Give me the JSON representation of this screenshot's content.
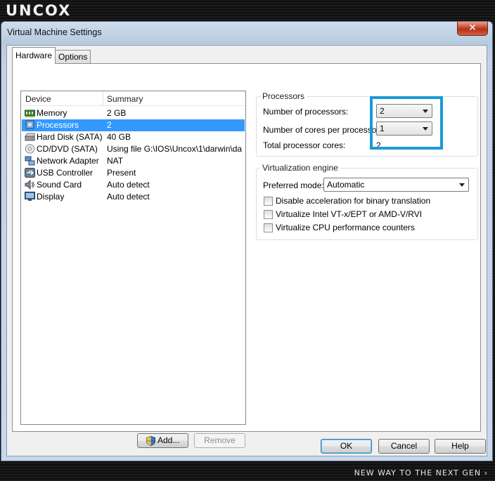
{
  "brand": {
    "logo_text": "UNCOX",
    "tagline": "NEW WAY TO THE NEXT GEN ›"
  },
  "window": {
    "title": "Virtual Machine Settings",
    "close_symbol": "✕"
  },
  "tabs": [
    {
      "label": "Hardware",
      "active": true
    },
    {
      "label": "Options",
      "active": false
    }
  ],
  "device_list": {
    "columns": [
      "Device",
      "Summary"
    ],
    "rows": [
      {
        "name": "Memory",
        "summary": "2 GB",
        "icon": "memory-icon",
        "selected": false
      },
      {
        "name": "Processors",
        "summary": "2",
        "icon": "processor-icon",
        "selected": true
      },
      {
        "name": "Hard Disk (SATA)",
        "summary": "40 GB",
        "icon": "hard-disk-icon",
        "selected": false
      },
      {
        "name": "CD/DVD (SATA)",
        "summary": "Using file G:\\IOS\\Uncox\\1\\darwin\\da...",
        "icon": "cd-dvd-icon",
        "selected": false
      },
      {
        "name": "Network Adapter",
        "summary": "NAT",
        "icon": "network-adapter-icon",
        "selected": false
      },
      {
        "name": "USB Controller",
        "summary": "Present",
        "icon": "usb-icon",
        "selected": false
      },
      {
        "name": "Sound Card",
        "summary": "Auto detect",
        "icon": "speaker-icon",
        "selected": false
      },
      {
        "name": "Display",
        "summary": "Auto detect",
        "icon": "monitor-icon",
        "selected": false
      }
    ],
    "add_label": "Add...",
    "remove_label": "Remove"
  },
  "processors": {
    "group_title": "Processors",
    "num_processors_label": "Number of processors:",
    "num_processors_value": "2",
    "cores_label": "Number of cores per processor:",
    "cores_value": "1",
    "total_label": "Total processor cores:",
    "total_value": "2"
  },
  "virtualization": {
    "group_title": "Virtualization engine",
    "mode_label": "Preferred mode:",
    "mode_value": "Automatic",
    "options": [
      {
        "label": "Disable acceleration for binary translation",
        "checked": false
      },
      {
        "label": "Virtualize Intel VT-x/EPT or AMD-V/RVI",
        "checked": false
      },
      {
        "label": "Virtualize CPU performance counters",
        "checked": false
      }
    ]
  },
  "footer": {
    "ok_label": "OK",
    "cancel_label": "Cancel",
    "help_label": "Help"
  },
  "colors": {
    "selection": "#3399ff",
    "highlight_box": "#1a9ad6"
  }
}
